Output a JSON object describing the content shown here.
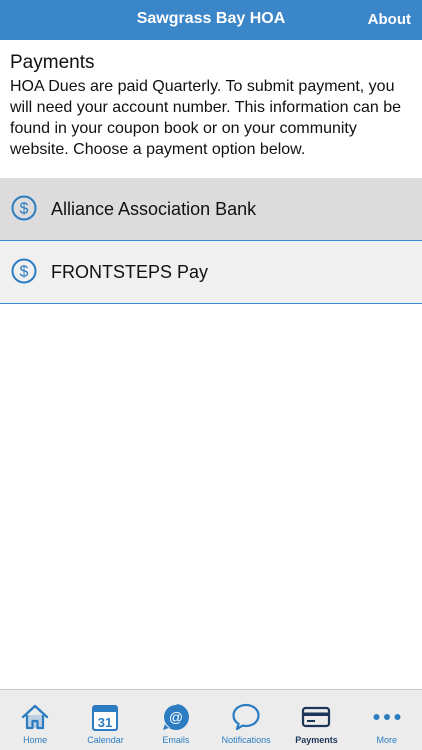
{
  "header": {
    "title": "Sawgrass Bay HOA",
    "about_label": "About"
  },
  "intro": {
    "title": "Payments",
    "text": "HOA Dues are paid Quarterly. To submit payment, you will need your account number. This information can be found in your coupon book or on your community website. Choose a payment option below."
  },
  "payment_options": [
    {
      "label": "Alliance Association Bank",
      "icon": "dollar-circle-icon",
      "selected": true
    },
    {
      "label": "FRONTSTEPS Pay",
      "icon": "dollar-circle-icon",
      "selected": false
    }
  ],
  "tabs": [
    {
      "label": "Home",
      "icon": "home-icon",
      "active": false
    },
    {
      "label": "Calendar",
      "icon": "calendar-icon",
      "icon_text": "31",
      "active": false
    },
    {
      "label": "Emails",
      "icon": "email-at-icon",
      "active": false
    },
    {
      "label": "Notifications",
      "icon": "speech-bubble-icon",
      "active": false
    },
    {
      "label": "Payments",
      "icon": "credit-card-icon",
      "active": true
    },
    {
      "label": "More",
      "icon": "more-dots-icon",
      "active": false
    }
  ],
  "colors": {
    "header_bg": "#3a86c8",
    "accent": "#2c7cc1",
    "active_tab": "#1d3557",
    "selected_row": "#dcdcdc",
    "row_bg": "#f0f0f0"
  }
}
